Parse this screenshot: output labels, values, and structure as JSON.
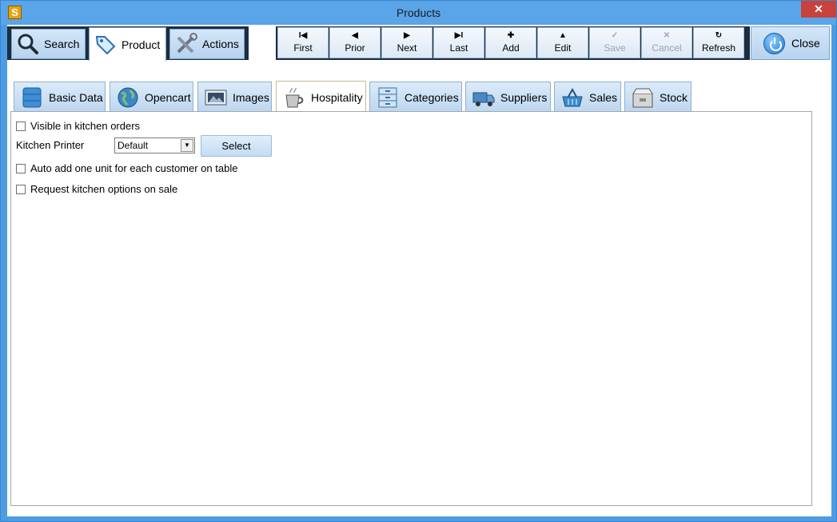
{
  "window": {
    "title": "Products",
    "app_icon_letter": "S"
  },
  "main_tabs": [
    {
      "label": "Search",
      "icon": "magnifier-icon"
    },
    {
      "label": "Product",
      "icon": "price-tag-icon"
    },
    {
      "label": "Actions",
      "icon": "tools-icon"
    }
  ],
  "nav_buttons": [
    {
      "label": "First",
      "glyph": "I◀",
      "enabled": true
    },
    {
      "label": "Prior",
      "glyph": "◀",
      "enabled": true
    },
    {
      "label": "Next",
      "glyph": "▶",
      "enabled": true
    },
    {
      "label": "Last",
      "glyph": "▶I",
      "enabled": true
    },
    {
      "label": "Add",
      "glyph": "✚",
      "enabled": true
    },
    {
      "label": "Edit",
      "glyph": "▲",
      "enabled": true
    },
    {
      "label": "Save",
      "glyph": "✓",
      "enabled": false
    },
    {
      "label": "Cancel",
      "glyph": "✕",
      "enabled": false
    },
    {
      "label": "Refresh",
      "glyph": "↻",
      "enabled": true
    }
  ],
  "close_button": {
    "label": "Close",
    "icon": "power-icon"
  },
  "sub_tabs": [
    {
      "label": "Basic Data",
      "icon": "database-icon"
    },
    {
      "label": "Opencart",
      "icon": "globe-icon"
    },
    {
      "label": "Images",
      "icon": "image-icon"
    },
    {
      "label": "Hospitality",
      "icon": "coffee-cup-icon"
    },
    {
      "label": "Categories",
      "icon": "cabinet-icon"
    },
    {
      "label": "Suppliers",
      "icon": "truck-icon"
    },
    {
      "label": "Sales",
      "icon": "basket-icon"
    },
    {
      "label": "Stock",
      "icon": "box-icon"
    }
  ],
  "hospitality": {
    "visible_kitchen": {
      "label": "Visible in kitchen orders",
      "checked": false
    },
    "kitchen_printer": {
      "label": "Kitchen Printer",
      "value": "Default"
    },
    "select_button": "Select",
    "auto_add": {
      "label": "Auto add one unit for each customer on table",
      "checked": false
    },
    "request_options": {
      "label": "Request kitchen options on sale",
      "checked": false
    }
  },
  "colors": {
    "titlebar": "#5aa4ea",
    "toolbar_dark": "#1d2d3e",
    "tab_blue": "#bcd6ef"
  }
}
